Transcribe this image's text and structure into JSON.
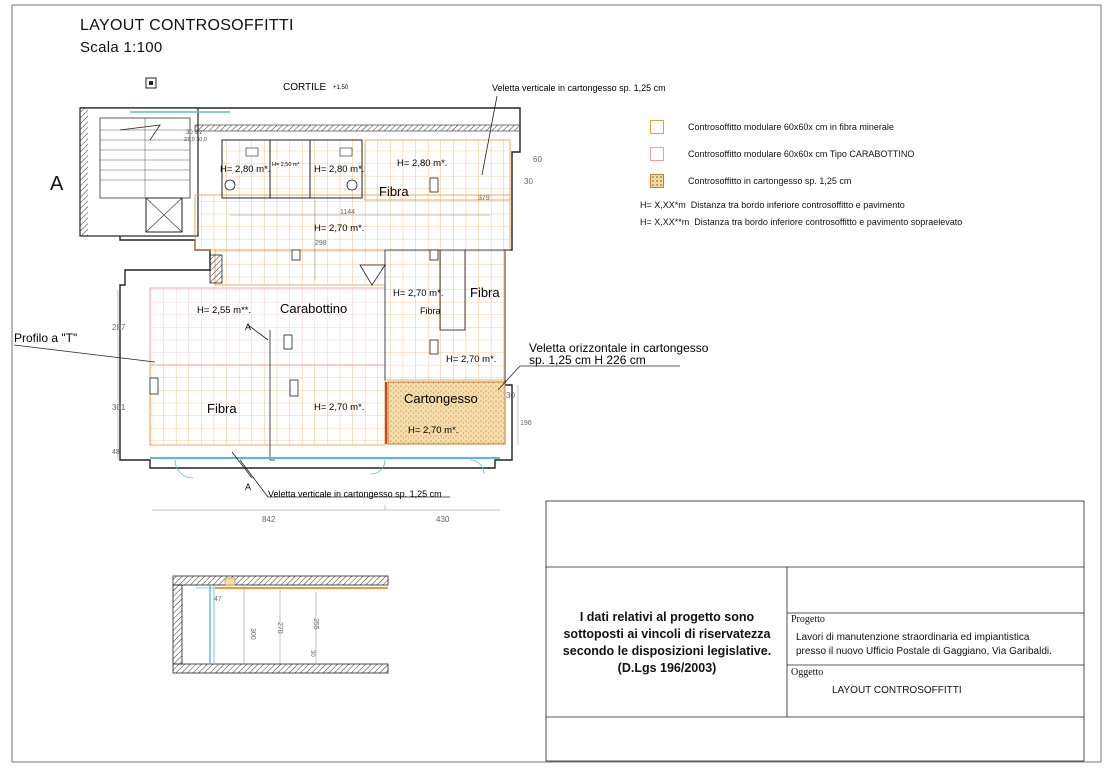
{
  "header": {
    "title": "LAYOUT CONTROSOFFITTI",
    "scale": "Scala 1:100"
  },
  "section_letter": "A",
  "legend": [
    {
      "label": "Controsoffitto modulare 60x60x cm in fibra minerale",
      "swatch": "fibra"
    },
    {
      "label": "Controsoffitto modulare 60x60x cm Tipo CARABOTTINO",
      "swatch": "carabottino"
    },
    {
      "label": "Controsoffitto in cartongesso sp. 1,25 cm",
      "swatch": "cartongesso"
    }
  ],
  "notes": [
    {
      "code": "H= X,XX*m",
      "text": "Distanza tra bordo inferiore controsoffitto e pavimento"
    },
    {
      "code": "H= X,XX**m",
      "text": "Distanza tra bordo inferiore controsoffitto e pavimento sopraelevato"
    }
  ],
  "plan": {
    "cortile": "CORTILE",
    "cortile_level": "+1.50",
    "veletta_verticale_top": "Veletta verticale in cartongesso sp. 1,25 cm",
    "veletta_verticale_bottom": "Veletta verticale in cartongesso sp. 1,25 cm",
    "veletta_orizzontale_1": "Veletta orizzontale in cartongesso",
    "veletta_orizzontale_2": "sp. 1,25 cm H 226 cm",
    "profilo": "Profilo a \"T\"",
    "rooms": {
      "fibra_top": "Fibra",
      "fibra_right": "Fibra",
      "fibra_small": "Fibra",
      "fibra_left": "Fibra",
      "carabottino": "Carabottino",
      "cartongesso": "Cartongesso"
    },
    "heights": {
      "wc1": "H= 2,80 m*.",
      "wc2": "H= 2,80 m*.",
      "wc_small": "H= 2,50 m*",
      "top_right": "H= 2,80 m*.",
      "corridor": "H= 2,70 m*.",
      "carabottino": "H= 2,55 m**.",
      "right_room": "H= 2,70 m*.",
      "right_lower": "H= 2,70 m*.",
      "main_lower": "H= 2,70 m*.",
      "cartongesso": "H= 2,70 m*."
    },
    "dims": {
      "d60": "60",
      "d30a": "30",
      "d30b": "30",
      "d1144": "1144",
      "d298": "298",
      "d379": "379",
      "d287": "287",
      "d301": "301",
      "d48": "48",
      "d842": "842",
      "d430": "430",
      "d196": "196",
      "stair": "30 6/z",
      "stair2": "27,0 30,0"
    },
    "section_marks": {
      "a1": "A",
      "a2": "A"
    }
  },
  "section": {
    "d47": "47",
    "d300": "300",
    "d270": "270",
    "d255": "255",
    "d30": "30"
  },
  "title_block": {
    "disclaimer_lines": [
      "I dati relativi al progetto sono",
      "sottoposti ai vincoli di riservatezza",
      "secondo le disposizioni legislative.",
      "(D.Lgs 196/2003)"
    ],
    "progetto_label": "Progetto",
    "progetto_line1": "Lavori di manutenzione straordinaria ed impiantistica",
    "progetto_line2": "presso il nuovo Ufficio Postale di Gaggiano, Via Garibaldi.",
    "oggetto_label": "Oggetto",
    "oggetto_value": "LAYOUT CONTROSOFFITTI"
  },
  "colors": {
    "fibra": "#e89a3c",
    "carabottino": "#e8a0a8",
    "cartongesso": "#f3d9a4",
    "glass": "#5fb8d8"
  }
}
